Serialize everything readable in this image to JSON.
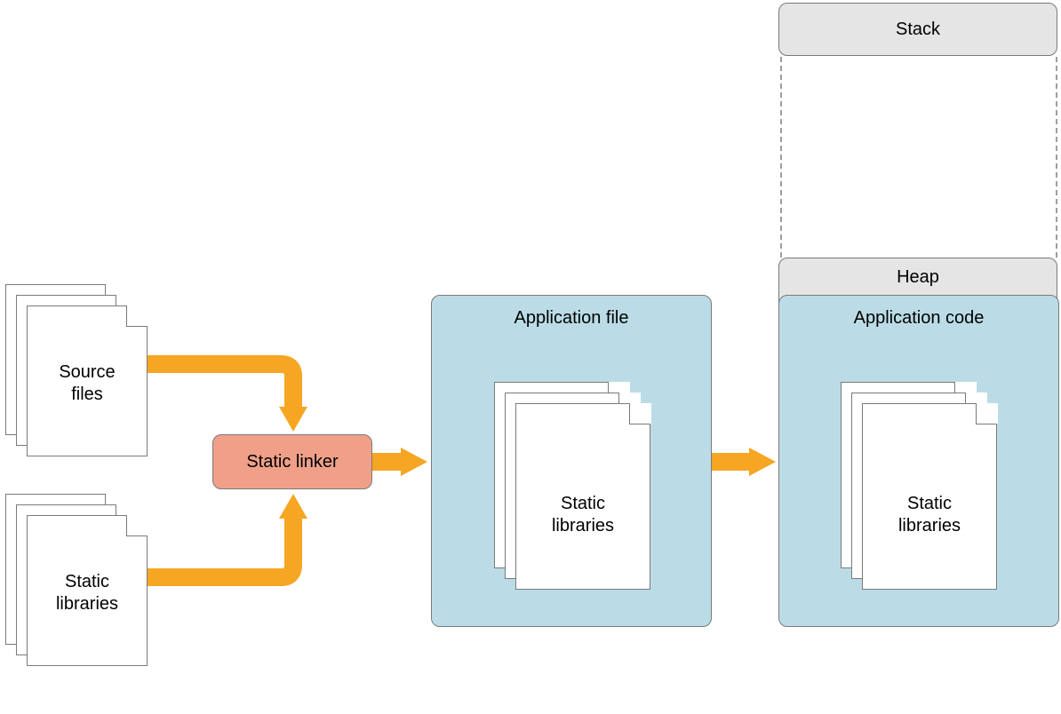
{
  "labels": {
    "source_files": "Source\nfiles",
    "static_libraries": "Static\nlibraries",
    "static_linker": "Static linker",
    "application_file": "Application file",
    "application_code": "Application code",
    "heap": "Heap",
    "stack": "Stack",
    "inner_static_libraries_1": "Static\nlibraries",
    "inner_static_libraries_2": "Static\nlibraries"
  },
  "colors": {
    "blue": "#bbdce6",
    "gray": "#e5e5e5",
    "red": "#f0a089",
    "arrow": "#f6a623",
    "border": "#7a7a7a"
  }
}
